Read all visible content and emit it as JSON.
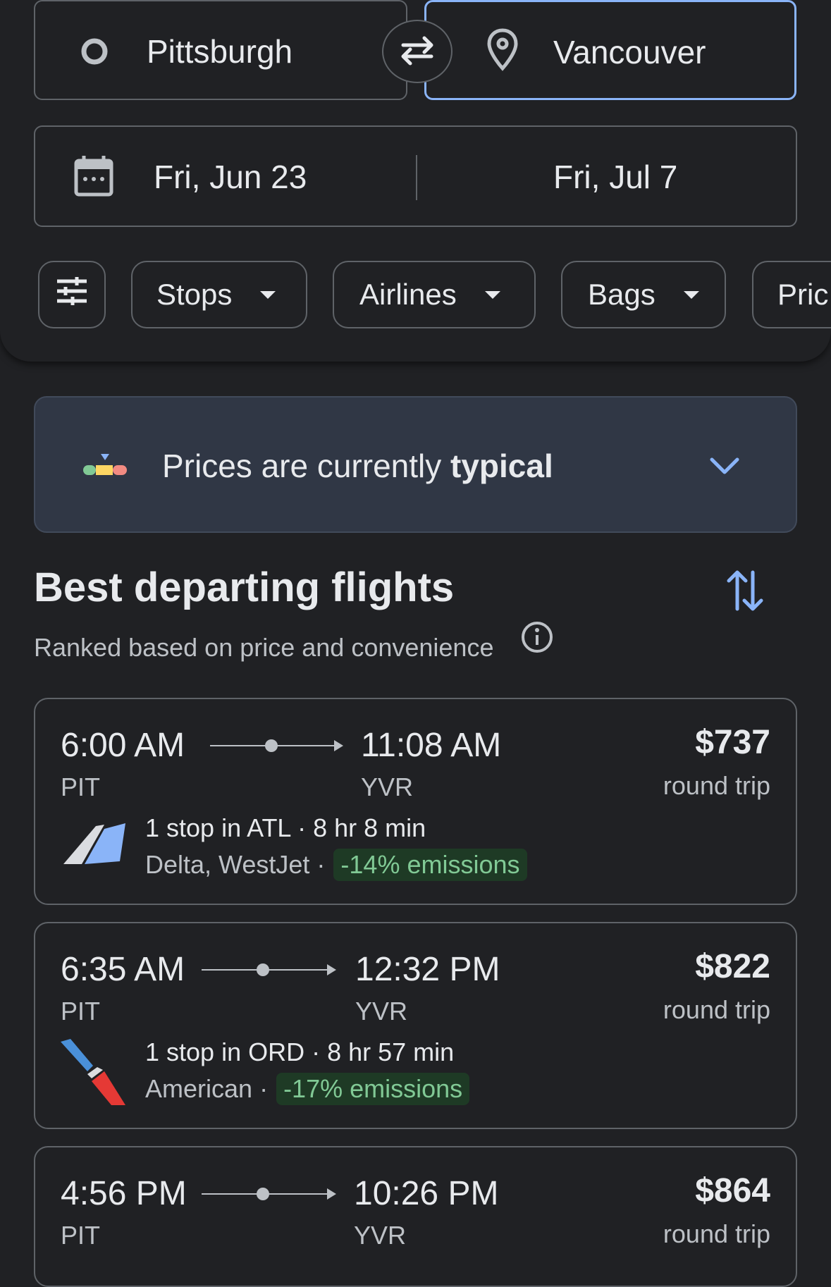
{
  "search": {
    "origin": "Pittsburgh",
    "destination": "Vancouver",
    "depart_date": "Fri, Jun 23",
    "return_date": "Fri, Jul 7"
  },
  "filters": {
    "chips": [
      "Stops",
      "Airlines",
      "Bags",
      "Pric"
    ]
  },
  "price_insight": {
    "text_prefix": "Prices are currently ",
    "text_emphasis": "typical"
  },
  "section": {
    "title": "Best departing flights",
    "subtitle": "Ranked based on price and convenience"
  },
  "flights": [
    {
      "depart_time": "6:00 AM",
      "arrive_time": "11:08 AM",
      "from": "PIT",
      "to": "YVR",
      "price": "$737",
      "trip_type": "round trip",
      "stops": "1 stop in ATL",
      "duration": "8 hr 8 min",
      "airlines": "Delta, WestJet",
      "emissions": "-14% emissions",
      "logo_icon": "delta-westjet-logo-icon"
    },
    {
      "depart_time": "6:35 AM",
      "arrive_time": "12:32 PM",
      "from": "PIT",
      "to": "YVR",
      "price": "$822",
      "trip_type": "round trip",
      "stops": "1 stop in ORD",
      "duration": "8 hr 57 min",
      "airlines": "American",
      "emissions": "-17% emissions",
      "logo_icon": "american-airlines-logo-icon"
    },
    {
      "depart_time": "4:56 PM",
      "arrive_time": "10:26 PM",
      "from": "PIT",
      "to": "YVR",
      "price": "$864",
      "trip_type": "round trip"
    }
  ],
  "colors": {
    "background": "#202124",
    "accent": "#8ab4f8",
    "emissions_green": "#81c995",
    "border": "#5f6368"
  }
}
